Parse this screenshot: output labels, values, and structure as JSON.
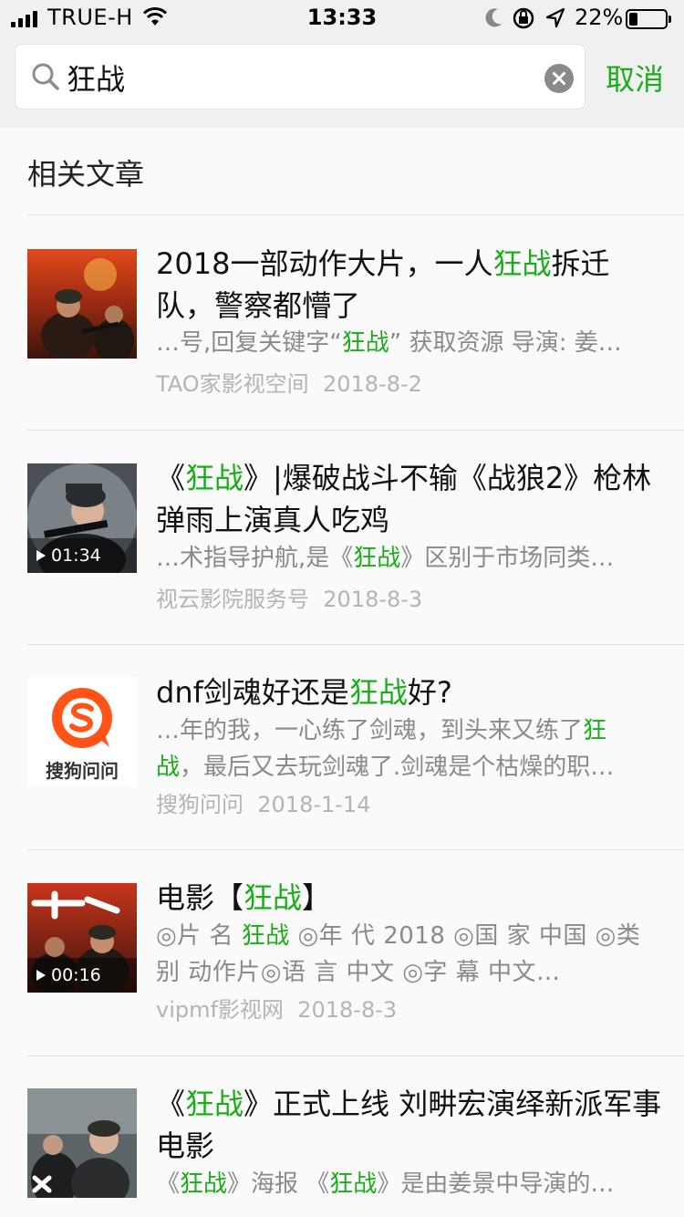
{
  "status_bar": {
    "carrier": "TRUE-H",
    "time": "13:33",
    "battery": "22%"
  },
  "search": {
    "query": "狂战",
    "cancel_label": "取消"
  },
  "section_title": "相关文章",
  "highlight_color": "#1aad19",
  "articles": [
    {
      "title": [
        "2018一部动作大片，一人",
        "狂战",
        "拆迁队，警察都懵了"
      ],
      "snippet": [
        "…号,回复关键字“",
        "狂战",
        "” 获取资源 导演: 姜…"
      ],
      "source": "TAO家影视空间",
      "date": "2018-8-2",
      "duration": ""
    },
    {
      "title": [
        "《",
        "狂战",
        "》|爆破战斗不输《战狼2》枪林弹雨上演真人吃鸡"
      ],
      "snippet": [
        "…术指导护航,是《",
        "狂战",
        "》区别于市场同类…"
      ],
      "source": "视云影院服务号",
      "date": "2018-8-3",
      "duration": "01:34"
    },
    {
      "title": [
        "dnf剑魂好还是",
        "狂战",
        "好?"
      ],
      "snippet": [
        "…年的我，一心练了剑魂，到头来又练了",
        "狂战",
        "，最后又去玩剑魂了.剑魂是个枯燥的职…"
      ],
      "source": "搜狗问问",
      "date": "2018-1-14",
      "duration": "",
      "logo_text": "搜狗问问"
    },
    {
      "title": [
        "电影【",
        "狂战",
        "】"
      ],
      "snippet": [
        "◎片 名 ",
        "狂战",
        " ◎年 代 2018 ◎国 家 中国 ◎类 别 动作片◎语 言 中文 ◎字 幕 中文…"
      ],
      "source": "vipmf影视网",
      "date": "2018-8-3",
      "duration": "00:16"
    },
    {
      "title": [
        "《",
        "狂战",
        "》正式上线 刘畊宏演绎新派军事电影"
      ],
      "snippet": [
        "《",
        "狂战",
        "》海报 《",
        "狂战",
        "》是由姜景中导演的…"
      ],
      "source": "",
      "date": "",
      "duration": ""
    }
  ]
}
